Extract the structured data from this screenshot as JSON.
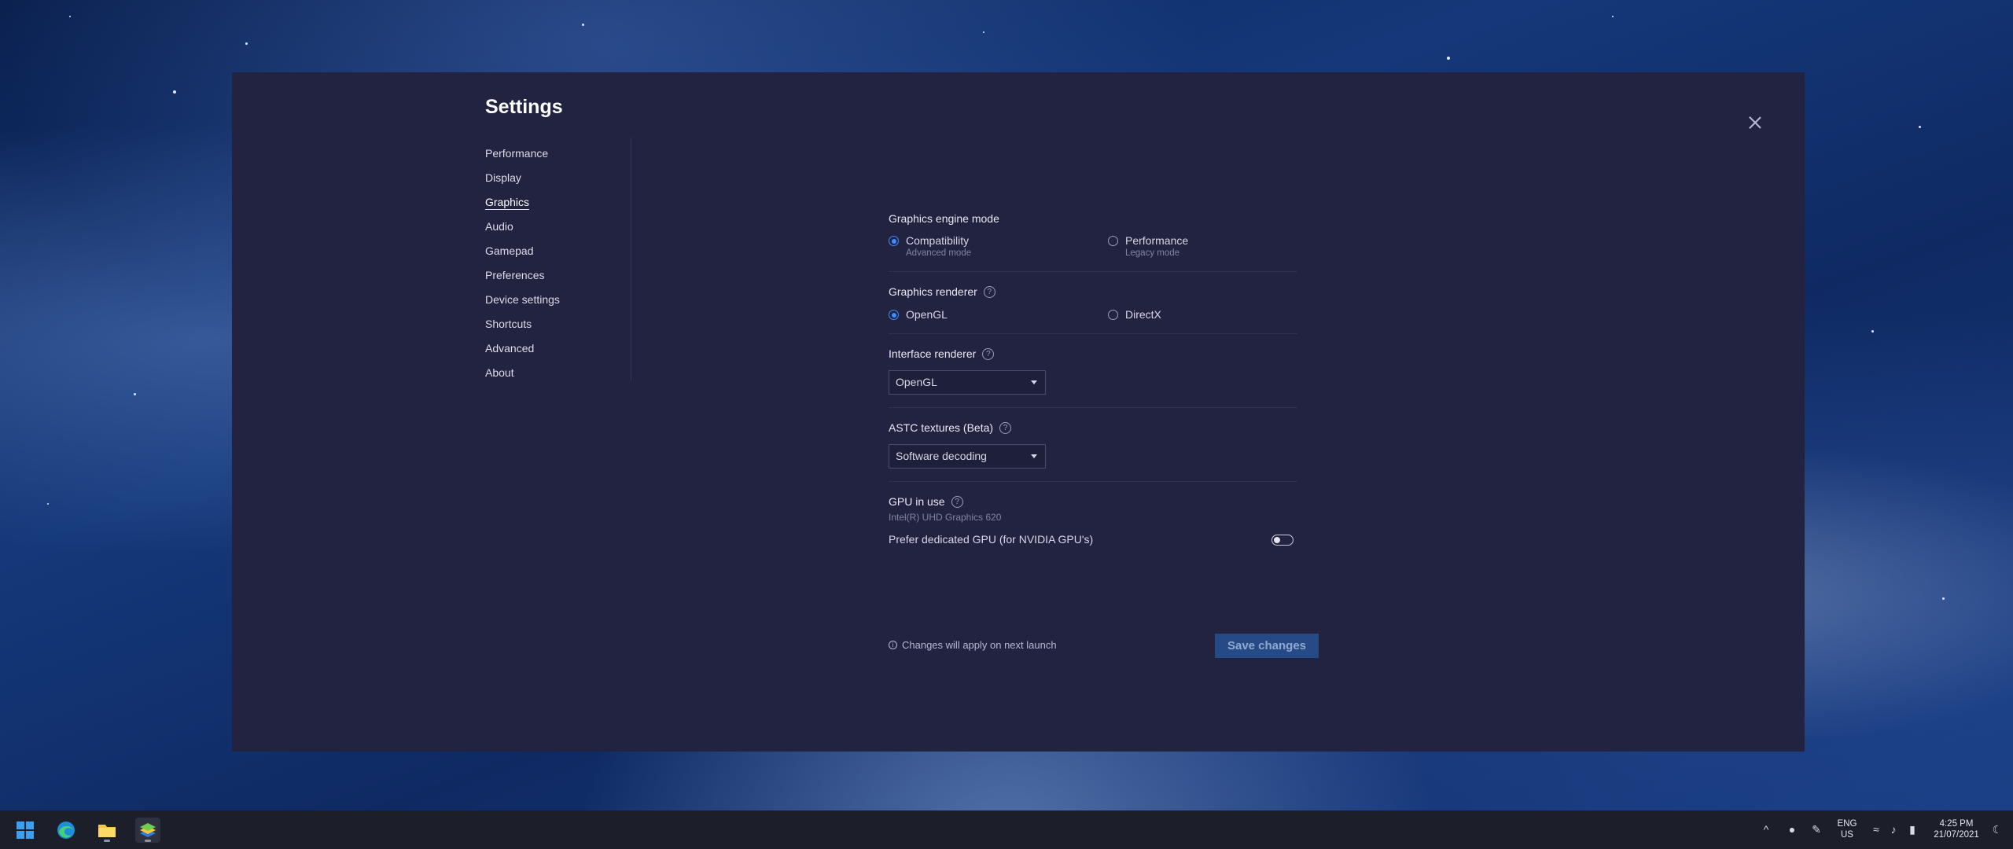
{
  "dialog": {
    "title": "Settings",
    "close_icon": "close-icon"
  },
  "nav": {
    "items": [
      {
        "label": "Performance",
        "active": false
      },
      {
        "label": "Display",
        "active": false
      },
      {
        "label": "Graphics",
        "active": true
      },
      {
        "label": "Audio",
        "active": false
      },
      {
        "label": "Gamepad",
        "active": false
      },
      {
        "label": "Preferences",
        "active": false
      },
      {
        "label": "Device settings",
        "active": false
      },
      {
        "label": "Shortcuts",
        "active": false
      },
      {
        "label": "Advanced",
        "active": false
      },
      {
        "label": "About",
        "active": false
      }
    ]
  },
  "graphics": {
    "engine_mode": {
      "title": "Graphics engine mode",
      "options": [
        {
          "label": "Compatibility",
          "sub": "Advanced mode",
          "checked": true
        },
        {
          "label": "Performance",
          "sub": "Legacy mode",
          "checked": false
        }
      ]
    },
    "renderer": {
      "title": "Graphics renderer",
      "options": [
        {
          "label": "OpenGL",
          "checked": true
        },
        {
          "label": "DirectX",
          "checked": false
        }
      ]
    },
    "interface_renderer": {
      "title": "Interface renderer",
      "value": "OpenGL"
    },
    "astc": {
      "title": "ASTC textures (Beta)",
      "value": "Software decoding"
    },
    "gpu": {
      "title": "GPU in use",
      "name": "Intel(R) UHD Graphics 620",
      "prefer_label": "Prefer dedicated GPU (for NVIDIA GPU's)",
      "prefer_enabled": false
    }
  },
  "footer": {
    "note": "Changes will apply on next launch",
    "save_label": "Save changes"
  },
  "taskbar": {
    "lang_top": "ENG",
    "lang_bottom": "US",
    "time": "4:25 PM",
    "date": "21/07/2021"
  },
  "colors": {
    "dialog_bg": "#222341",
    "accent": "#3c8dff",
    "save_button": "#254a85"
  }
}
